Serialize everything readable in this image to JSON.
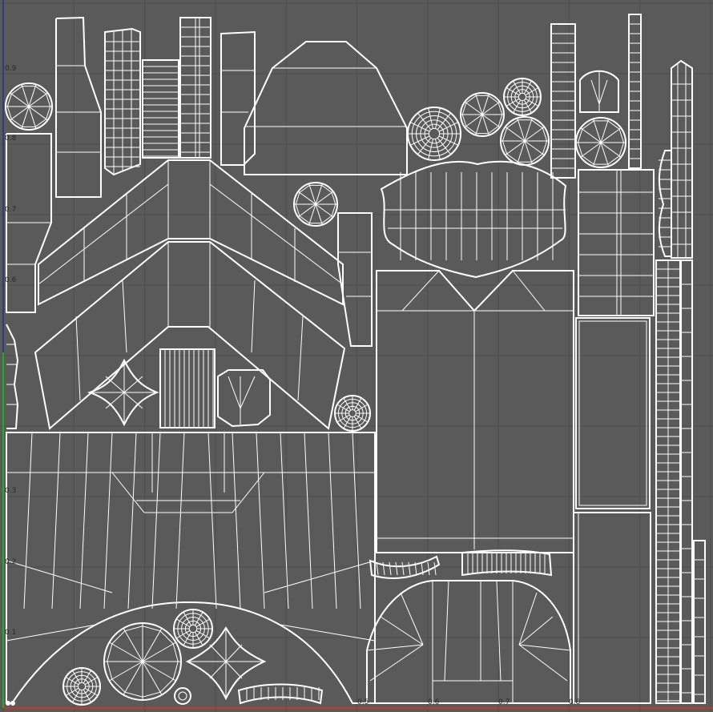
{
  "editor": {
    "background": "#5a5a5a",
    "grid_color": "#4c4c4c",
    "wire_color": "#ffffff",
    "u_axis_color": "#c0392b",
    "v_axis_color": "#22aa22",
    "border_color": "#2f3a8a"
  },
  "ticks": {
    "y": [
      "0.9",
      "0.8",
      "0.7",
      "0.6",
      "0.3",
      "0.2",
      "0.1"
    ],
    "x": [
      "0.5",
      "0.6",
      "0.7",
      "0.8"
    ]
  }
}
